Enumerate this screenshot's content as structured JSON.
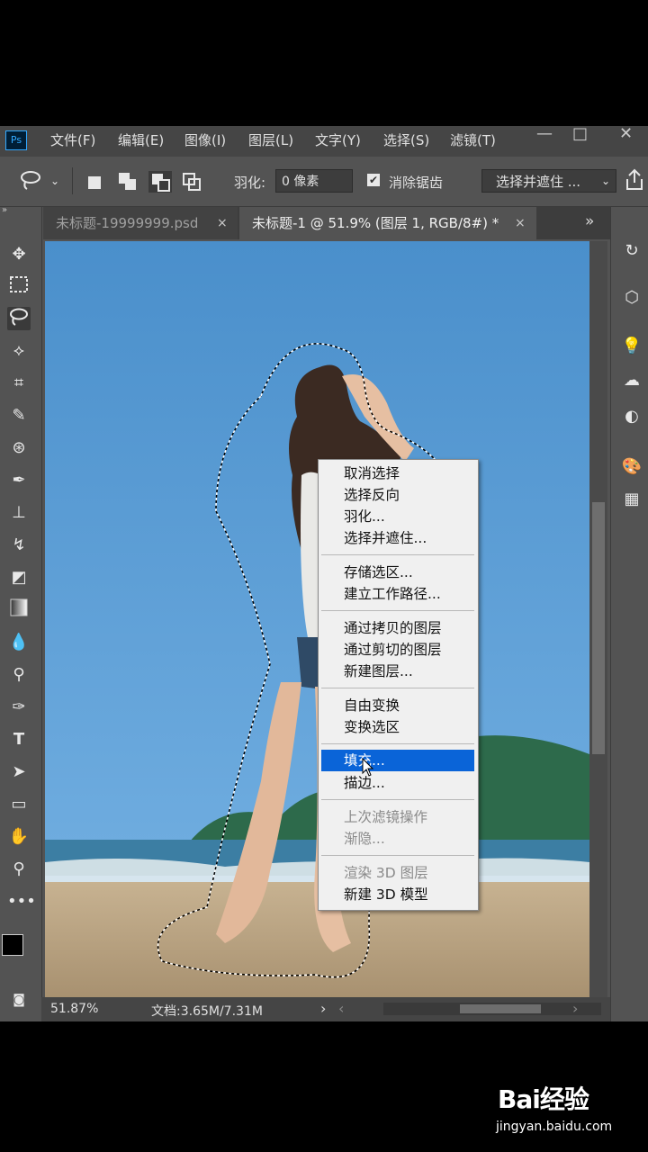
{
  "menubar": {
    "logo": "Ps",
    "items": [
      "文件(F)",
      "编辑(E)",
      "图像(I)",
      "图层(L)",
      "文字(Y)",
      "选择(S)",
      "滤镜(T)"
    ],
    "window_buttons": [
      "—",
      "□",
      "✕"
    ]
  },
  "options_bar": {
    "feather_label": "羽化:",
    "feather_value": "0 像素",
    "antialias_label": "消除锯齿",
    "antialias_checked": true,
    "select_mask_label": "选择并遮住 ..."
  },
  "tabs": [
    {
      "title": "未标题-19999999.psd",
      "active": false
    },
    {
      "title": "未标题-1 @ 51.9% (图层 1, RGB/8#) *",
      "active": true
    }
  ],
  "tab_close": "×",
  "tab_overflow": "»",
  "context_menu": {
    "items": [
      {
        "label": "取消选择"
      },
      {
        "label": "选择反向"
      },
      {
        "label": "羽化..."
      },
      {
        "label": "选择并遮住..."
      },
      {
        "label": "存储选区..."
      },
      {
        "label": "建立工作路径..."
      },
      {
        "label": "通过拷贝的图层"
      },
      {
        "label": "通过剪切的图层"
      },
      {
        "label": "新建图层..."
      },
      {
        "label": "自由变换"
      },
      {
        "label": "变换选区"
      },
      {
        "label": "填充..."
      },
      {
        "label": "描边..."
      },
      {
        "label": "上次滤镜操作"
      },
      {
        "label": "渐隐..."
      },
      {
        "label": "渲染 3D 图层"
      },
      {
        "label": "新建 3D 模型"
      }
    ],
    "highlighted": "填充...",
    "disabled": [
      "上次滤镜操作",
      "渐隐...",
      "渲染 3D 图层"
    ]
  },
  "status": {
    "zoom": "51.87%",
    "doc_size": "文档:3.65M/7.31M"
  },
  "watermark": {
    "brand": "Bai经验",
    "url": "jingyan.baidu.com"
  },
  "colors": {
    "sky": "#4a8fc9",
    "highlight": "#0a64d8",
    "panel": "#535353"
  }
}
